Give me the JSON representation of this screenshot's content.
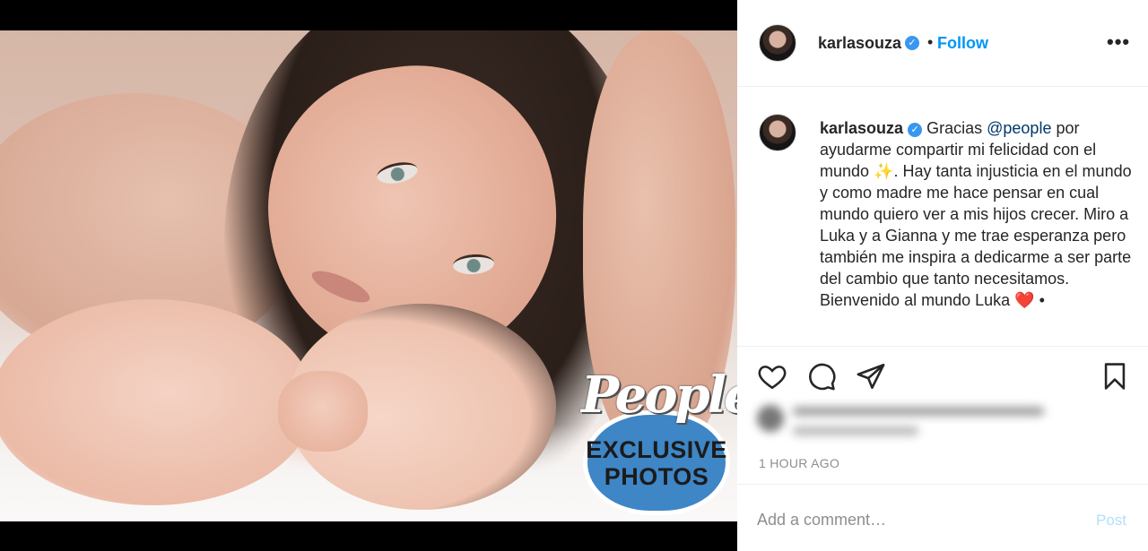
{
  "post": {
    "username": "karlasouza",
    "follow_label": "Follow",
    "separator": "•",
    "more_label": "•••"
  },
  "badge": {
    "brand": "People",
    "line1": "EXCLUSIVE",
    "line2": "PHOTOS"
  },
  "caption": {
    "username": "karlasouza",
    "part1": "Gracias ",
    "mention": "@people",
    "part2": " por ayudarme compartir mi felicidad con el mundo ✨. Hay tanta injusticia en el mundo y como madre me hace pensar en cual mundo quiero ver a mis hijos crecer. Miro a Luka y a Gianna y me trae esperanza pero también me inspira a dedicarme a ser parte del cambio que tanto necesitamos. Bienvenido al mundo Luka ",
    "heart": "❤️",
    "end": " •"
  },
  "timestamp": "1 HOUR AGO",
  "comment": {
    "placeholder": "Add a comment…",
    "post_label": "Post"
  },
  "icons": {
    "like": "heart-icon",
    "comment": "comment-icon",
    "share": "share-icon",
    "save": "bookmark-icon"
  },
  "colors": {
    "follow": "#0095f6",
    "verified": "#3897f0",
    "post_disabled": "#b2dffc",
    "badge_blue": "#3e86c6"
  }
}
